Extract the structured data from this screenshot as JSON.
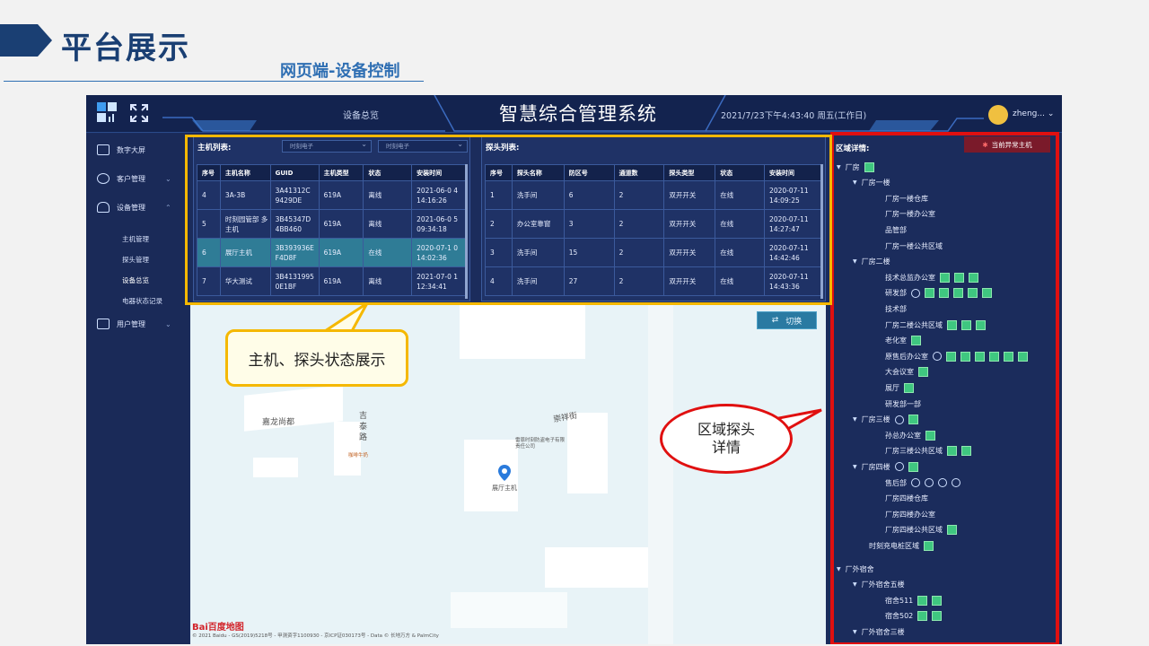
{
  "slide": {
    "title": "平台展示",
    "subtitle": "网页端-设备控制"
  },
  "topbar": {
    "nav_tab": "设备总览",
    "system_title": "智慧综合管理系统",
    "datetime": "2021/7/23下午4:43:40 周五(工作日)",
    "user": "zheng... ⌄"
  },
  "sidebar": {
    "items": [
      {
        "label": "数字大屏",
        "has_chevron": false
      },
      {
        "label": "客户管理",
        "has_chevron": true
      },
      {
        "label": "设备管理",
        "has_chevron": true
      },
      {
        "label": "用户管理",
        "has_chevron": true
      }
    ],
    "sub_items": [
      "主机管理",
      "探头管理",
      "设备总览",
      "电器状态记录"
    ],
    "active_sub": "设备总览"
  },
  "host_panel": {
    "title": "主机列表:",
    "select1": "时刻电子",
    "select2": "时刻电子",
    "columns": [
      "序号",
      "主机名称",
      "GUID",
      "主机类型",
      "状态",
      "安装时间"
    ],
    "rows": [
      [
        "4",
        "3A-3B",
        "3A41312C 9429DE",
        "619A",
        "离线",
        "2021-06-0 4 14:16:26"
      ],
      [
        "5",
        "时刻园管部 多主机",
        "3B45347D 4BB460",
        "619A",
        "离线",
        "2021-06-0 5 09:34:18"
      ],
      [
        "6",
        "展厅主机",
        "3B393936E F4D8F",
        "619A",
        "在线",
        "2020-07-1 0 14:02:36"
      ],
      [
        "7",
        "华大测试",
        "3B4131995 0E1BF",
        "619A",
        "离线",
        "2021-07-0 1 12:34:41"
      ]
    ],
    "highlight_row": 2
  },
  "probe_panel": {
    "title": "探头列表:",
    "columns": [
      "序号",
      "探头名称",
      "防区号",
      "通道数",
      "探头类型",
      "状态",
      "安装时间"
    ],
    "rows": [
      [
        "1",
        "洗手间",
        "6",
        "2",
        "双开开关",
        "在线",
        "2020-07-11 14:09:25"
      ],
      [
        "2",
        "办公室靠窗",
        "3",
        "2",
        "双开开关",
        "在线",
        "2020-07-11 14:27:47"
      ],
      [
        "3",
        "洗手间",
        "15",
        "2",
        "双开开关",
        "在线",
        "2020-07-11 14:42:46"
      ],
      [
        "4",
        "洗手间",
        "27",
        "2",
        "双开开关",
        "在线",
        "2020-07-11 14:43:36"
      ]
    ]
  },
  "map": {
    "switch_label": "切换",
    "labels": [
      "嘉龙尚都",
      "吉泰路",
      "崇祥街",
      "展厅主机",
      "咖啡牛奶",
      "雷恩时刻防盗电子有限责任公司"
    ],
    "baidu": "Bai百度地图",
    "copyright": "© 2021 Baidu - GS(2019)5218号 - 甲测资字1100930 - 京ICP证030173号 - Data © 长地万方 & PalmCity"
  },
  "region_panel": {
    "title": "区域详情:",
    "alarm_button": "当前异常主机",
    "tree": [
      {
        "label": "厂房",
        "level": 0,
        "arrow": true,
        "icons": [
          "g"
        ]
      },
      {
        "label": "厂房一楼",
        "level": 1,
        "arrow": true,
        "icons": []
      },
      {
        "label": "厂房一楼仓库",
        "level": 2,
        "arrow": false,
        "icons": []
      },
      {
        "label": "厂房一楼办公室",
        "level": 2,
        "arrow": false,
        "icons": []
      },
      {
        "label": "品管部",
        "level": 2,
        "arrow": false,
        "icons": []
      },
      {
        "label": "厂房一楼公共区域",
        "level": 2,
        "arrow": false,
        "icons": []
      },
      {
        "label": "厂房二楼",
        "level": 1,
        "arrow": true,
        "icons": []
      },
      {
        "label": "技术总监办公室",
        "level": 2,
        "arrow": false,
        "icons": [
          "g",
          "g",
          "g"
        ]
      },
      {
        "label": "研发部",
        "level": 2,
        "arrow": false,
        "icons": [
          "o",
          "g",
          "g",
          "g",
          "g",
          "g"
        ]
      },
      {
        "label": "技术部",
        "level": 2,
        "arrow": false,
        "icons": []
      },
      {
        "label": "厂房二楼公共区域",
        "level": 2,
        "arrow": false,
        "icons": [
          "g",
          "g",
          "g"
        ]
      },
      {
        "label": "老化室",
        "level": 2,
        "arrow": false,
        "icons": [
          "g"
        ]
      },
      {
        "label": "原售后办公室",
        "level": 2,
        "arrow": false,
        "icons": [
          "o",
          "g",
          "g",
          "g",
          "g",
          "g",
          "g"
        ]
      },
      {
        "label": "大会议室",
        "level": 2,
        "arrow": false,
        "icons": [
          "g"
        ]
      },
      {
        "label": "展厅",
        "level": 2,
        "arrow": false,
        "icons": [
          "g"
        ]
      },
      {
        "label": "研发部一部",
        "level": 2,
        "arrow": false,
        "icons": []
      },
      {
        "label": "厂房三楼",
        "level": 1,
        "arrow": true,
        "icons": [
          "o",
          "g"
        ]
      },
      {
        "label": "孙总办公室",
        "level": 2,
        "arrow": false,
        "icons": [
          "g"
        ]
      },
      {
        "label": "厂房三楼公共区域",
        "level": 2,
        "arrow": false,
        "icons": [
          "g",
          "g"
        ]
      },
      {
        "label": "厂房四楼",
        "level": 1,
        "arrow": true,
        "icons": [
          "o",
          "g"
        ]
      },
      {
        "label": "售后部",
        "level": 2,
        "arrow": false,
        "icons": [
          "o",
          "o",
          "o",
          "o"
        ]
      },
      {
        "label": "厂房四楼仓库",
        "level": 2,
        "arrow": false,
        "icons": []
      },
      {
        "label": "厂房四楼办公室",
        "level": 2,
        "arrow": false,
        "icons": []
      },
      {
        "label": "厂房四楼公共区域",
        "level": 2,
        "arrow": false,
        "icons": [
          "g"
        ]
      },
      {
        "label": "时刻充电桩区域",
        "level": 1.5,
        "arrow": false,
        "icons": [
          "g"
        ]
      },
      {
        "label": "厂外宿舍",
        "level": 0,
        "arrow": true,
        "icons": [],
        "gap": true
      },
      {
        "label": "厂外宿舍五楼",
        "level": 1,
        "arrow": true,
        "icons": []
      },
      {
        "label": "宿舍511",
        "level": 2,
        "arrow": false,
        "icons": [
          "g",
          "g"
        ]
      },
      {
        "label": "宿舍502",
        "level": 2,
        "arrow": false,
        "icons": [
          "g",
          "g"
        ]
      },
      {
        "label": "厂外宿舍三楼",
        "level": 1,
        "arrow": true,
        "icons": []
      }
    ]
  },
  "callouts": {
    "status": "主机、探头状态展示",
    "region_line1": "区域探头",
    "region_line2": "详情"
  },
  "colors": {
    "slide_title": "#1a3f73",
    "accent_blue": "#2f6fb3",
    "app_bg": "#1b2c5c",
    "highlight": "#2f7c96",
    "yellow": "#f5b800",
    "red": "#e01010",
    "probe_green": "#3fc780"
  }
}
